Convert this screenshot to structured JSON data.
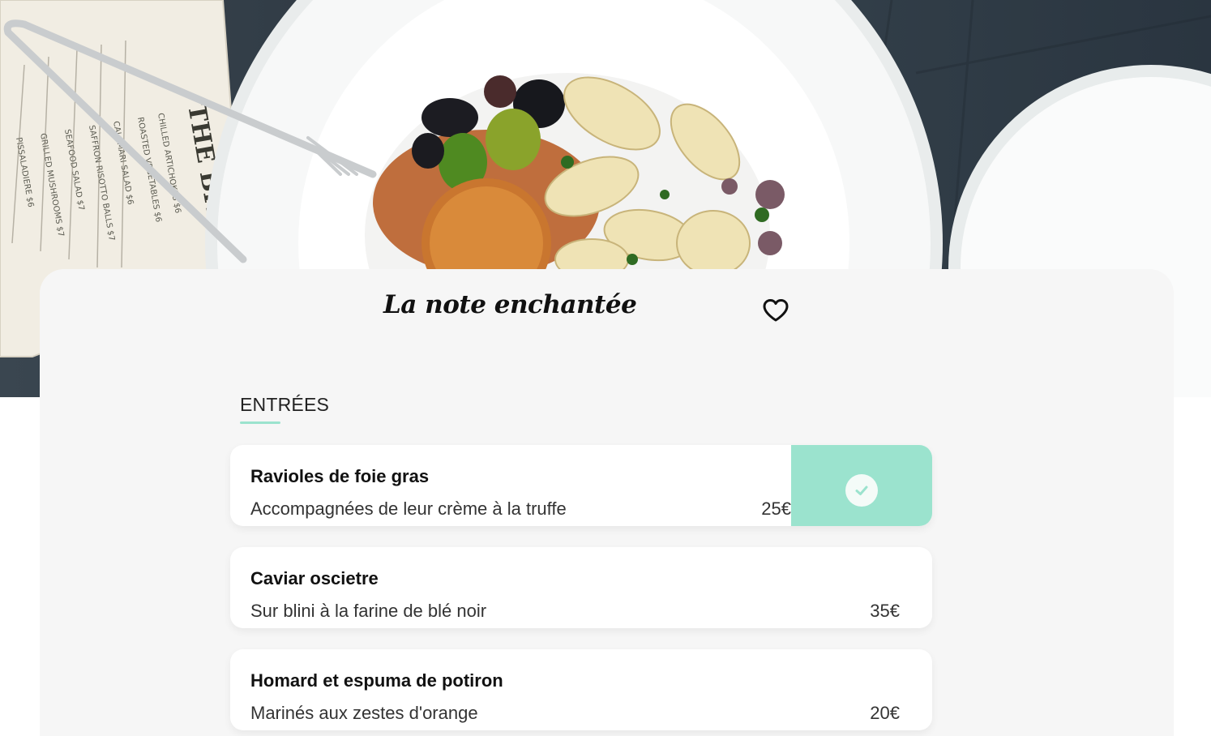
{
  "hero": {
    "menu_card_heading": "THE BITE",
    "menu_card_lines": [
      "CHILLED ARTICHOKES $6",
      "ROASTED VEGETABLES $6",
      "CALAMARI SALAD $6",
      "SAFFRON RISOTTO BALLS $7",
      "SEAFOOD SALAD $7",
      "GRILLED MUSHROOMS $7",
      "PISSALADIERE $6"
    ]
  },
  "restaurant": {
    "name": "La note enchantée"
  },
  "icons": {
    "favorite": "heart-outline-icon",
    "selected": "check-icon"
  },
  "colors": {
    "accent": "#9be3ce",
    "card_background": "#f6f6f6",
    "item_background": "#ffffff"
  },
  "menu": {
    "section_title": "ENTRÉES",
    "items": [
      {
        "name": "Ravioles de foie gras",
        "description": "Accompagnées de leur crème à la truffe",
        "price": "25€",
        "selected": true
      },
      {
        "name": "Caviar oscietre",
        "description": "Sur blini à la farine de blé noir",
        "price": "35€",
        "selected": false
      },
      {
        "name": "Homard et espuma de potiron",
        "description": "Marinés aux zestes d'orange",
        "price": "20€",
        "selected": false
      }
    ]
  }
}
